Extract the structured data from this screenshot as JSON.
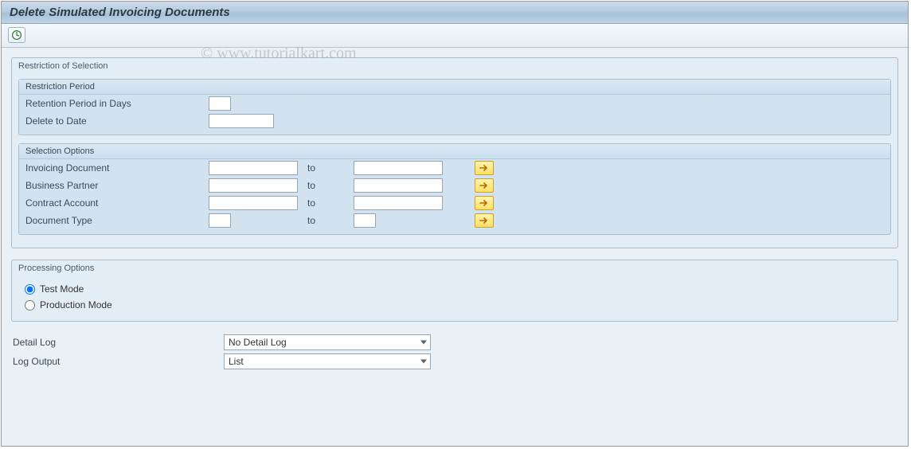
{
  "title": "Delete Simulated Invoicing Documents",
  "watermark": "© www.tutorialkart.com",
  "toolbar": {
    "execute_icon": "execute"
  },
  "restriction_group": {
    "title": "Restriction of Selection",
    "period_group": {
      "title": "Restriction Period",
      "retention_label": "Retention Period in Days",
      "retention_value": "",
      "delete_to_label": "Delete to Date",
      "delete_to_value": ""
    },
    "selection_group": {
      "title": "Selection Options",
      "to_label": "to",
      "rows": [
        {
          "label": "Invoicing Document",
          "from": "",
          "to": "",
          "size": "md"
        },
        {
          "label": "Business Partner",
          "from": "",
          "to": "",
          "size": "md"
        },
        {
          "label": "Contract Account",
          "from": "",
          "to": "",
          "size": "md"
        },
        {
          "label": "Document Type",
          "from": "",
          "to": "",
          "size": "xs"
        }
      ]
    }
  },
  "processing_group": {
    "title": "Processing Options",
    "test_label": "Test Mode",
    "prod_label": "Production Mode",
    "selected": "test"
  },
  "log": {
    "detail_label": "Detail Log",
    "detail_value": "No Detail Log",
    "output_label": "Log Output",
    "output_value": "List"
  }
}
